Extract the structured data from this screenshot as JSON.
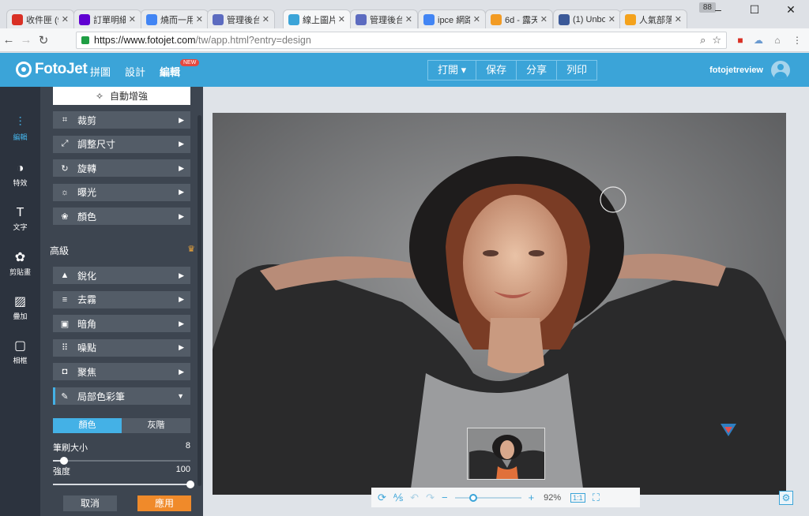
{
  "browser": {
    "tabs": [
      {
        "title": "收件匣 (9",
        "icon": "gmail-icon",
        "color": "#d93025"
      },
      {
        "title": "訂單明細",
        "icon": "yahoo-icon",
        "color": "#6001d2"
      },
      {
        "title": "燒而一用",
        "icon": "google-icon",
        "color": "#4285f4"
      },
      {
        "title": "管理後台",
        "icon": "chat-icon",
        "color": "#5c6bc0"
      },
      {
        "title": "線上圖片",
        "icon": "fotojet-icon",
        "color": "#3ba4d8"
      },
      {
        "title": "管理後台",
        "icon": "chat-icon",
        "color": "#5c6bc0"
      },
      {
        "title": "ipce 網路",
        "icon": "google-icon",
        "color": "#4285f4"
      },
      {
        "title": "6d - 露天",
        "icon": "ruten-icon",
        "color": "#f29b24"
      },
      {
        "title": "(1) Unbo",
        "icon": "facebook-icon",
        "color": "#3b5998"
      },
      {
        "title": "人氣部落",
        "icon": "blog-icon",
        "color": "#f4a21c"
      }
    ],
    "badge": "88",
    "url_base": "https://www.fotojet.com",
    "url_path": "/tw/app.html?entry=design"
  },
  "app": {
    "brand": "FotoJet",
    "nav": [
      "拼圖",
      "設計",
      "編輯"
    ],
    "new_badge": "NEW",
    "actions": [
      "打開 ▾",
      "保存",
      "分享",
      "列印"
    ],
    "user": "fotojetreview",
    "accent": "#3ba4d8"
  },
  "rail": [
    {
      "label": "編輯",
      "icon": "sliders-icon",
      "glyph": "⫶"
    },
    {
      "label": "特效",
      "icon": "halfcircle-icon",
      "glyph": "◑"
    },
    {
      "label": "文字",
      "icon": "text-icon",
      "glyph": "T"
    },
    {
      "label": "剪貼畫",
      "icon": "clipart-icon",
      "glyph": "✿"
    },
    {
      "label": "疊加",
      "icon": "overlay-icon",
      "glyph": "▨"
    },
    {
      "label": "相框",
      "icon": "frame-icon",
      "glyph": "▢"
    }
  ],
  "panel": {
    "auto_enhance": "自動增強",
    "basic_tools": [
      {
        "label": "裁剪",
        "icon": "crop-icon",
        "glyph": "⌗"
      },
      {
        "label": "調整尺寸",
        "icon": "resize-icon",
        "glyph": "⤢"
      },
      {
        "label": "旋轉",
        "icon": "rotate-icon",
        "glyph": "↻"
      },
      {
        "label": "曝光",
        "icon": "exposure-icon",
        "glyph": "☼"
      },
      {
        "label": "顏色",
        "icon": "color-icon",
        "glyph": "❀"
      }
    ],
    "advanced_title": "高級",
    "advanced_tools": [
      {
        "label": "銳化",
        "icon": "sharpen-icon",
        "glyph": "▲"
      },
      {
        "label": "去霧",
        "icon": "dehaze-icon",
        "glyph": "≡"
      },
      {
        "label": "暗角",
        "icon": "vignette-icon",
        "glyph": "▣"
      },
      {
        "label": "噪點",
        "icon": "noise-icon",
        "glyph": "⠿"
      },
      {
        "label": "聚焦",
        "icon": "focus-icon",
        "glyph": "◘"
      },
      {
        "label": "局部色彩筆",
        "icon": "brush-icon",
        "glyph": "✎"
      }
    ],
    "mode_color": "顏色",
    "mode_gray": "灰階",
    "brush_label": "筆刷大小",
    "brush_value": "8",
    "brush_fraction": 0.08,
    "strength_label": "強度",
    "strength_value": "100",
    "strength_fraction": 1.0,
    "cancel": "取消",
    "apply": "應用"
  },
  "canvas": {
    "zoom": "92%",
    "zoom_fraction": 0.25,
    "onetoone": "1:1"
  }
}
